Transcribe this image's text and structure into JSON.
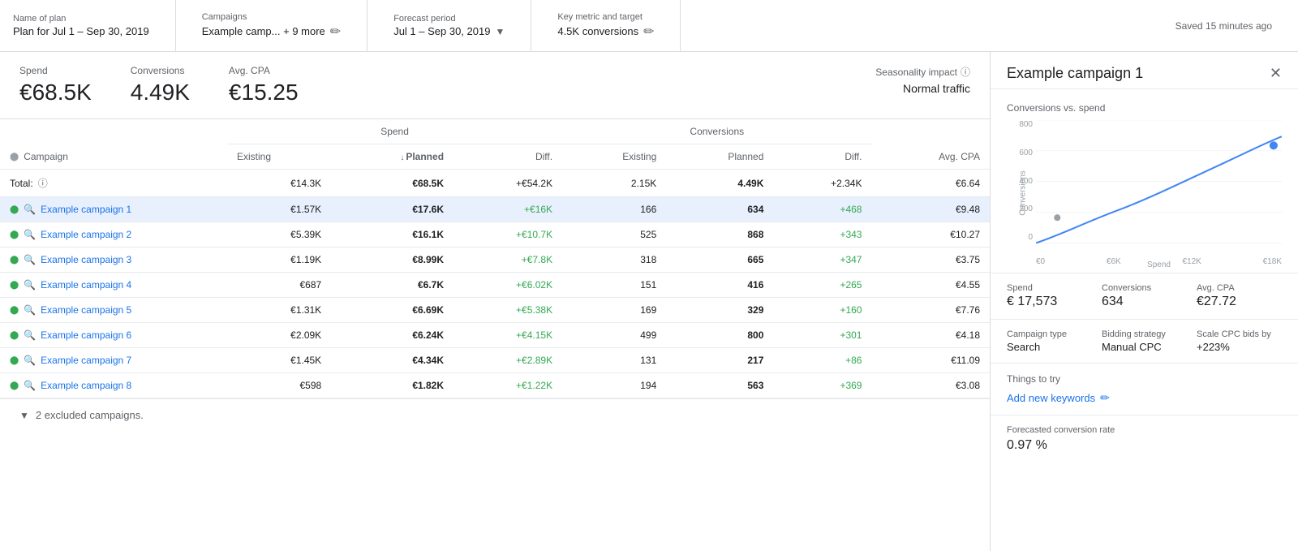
{
  "header": {
    "plan_name_label": "Name of plan",
    "plan_name": "Plan for Jul 1 – Sep 30, 2019",
    "campaigns_label": "Campaigns",
    "campaigns_value": "Example camp... + 9 more",
    "forecast_label": "Forecast period",
    "forecast_value": "Jul 1 – Sep 30, 2019",
    "metric_label": "Key metric and target",
    "metric_value": "4.5K conversions",
    "saved_text": "Saved 15 minutes ago"
  },
  "summary": {
    "spend_label": "Spend",
    "spend_value": "€68.5K",
    "conversions_label": "Conversions",
    "conversions_value": "4.49K",
    "avg_cpa_label": "Avg. CPA",
    "avg_cpa_value": "€15.25",
    "seasonality_label": "Seasonality impact",
    "seasonality_value": "Normal traffic"
  },
  "table": {
    "col_campaign": "Campaign",
    "col_spend_group": "Spend",
    "col_conv_group": "Conversions",
    "col_avg_cpa": "Avg. CPA",
    "col_existing": "Existing",
    "col_planned": "Planned",
    "col_diff": "Diff.",
    "total_label": "Total:",
    "total_spend_existing": "€14.3K",
    "total_spend_planned": "€68.5K",
    "total_spend_diff": "+€54.2K",
    "total_conv_existing": "2.15K",
    "total_conv_planned": "4.49K",
    "total_conv_diff": "+2.34K",
    "total_avg_cpa": "€6.64",
    "rows": [
      {
        "name": "Example campaign 1",
        "spend_existing": "€1.57K",
        "spend_planned": "€17.6K",
        "spend_diff": "+€16K",
        "conv_existing": "166",
        "conv_planned": "634",
        "conv_diff": "+468",
        "avg_cpa": "€9.48",
        "selected": true
      },
      {
        "name": "Example campaign 2",
        "spend_existing": "€5.39K",
        "spend_planned": "€16.1K",
        "spend_diff": "+€10.7K",
        "conv_existing": "525",
        "conv_planned": "868",
        "conv_diff": "+343",
        "avg_cpa": "€10.27",
        "selected": false
      },
      {
        "name": "Example campaign 3",
        "spend_existing": "€1.19K",
        "spend_planned": "€8.99K",
        "spend_diff": "+€7.8K",
        "conv_existing": "318",
        "conv_planned": "665",
        "conv_diff": "+347",
        "avg_cpa": "€3.75",
        "selected": false
      },
      {
        "name": "Example campaign 4",
        "spend_existing": "€687",
        "spend_planned": "€6.7K",
        "spend_diff": "+€6.02K",
        "conv_existing": "151",
        "conv_planned": "416",
        "conv_diff": "+265",
        "avg_cpa": "€4.55",
        "selected": false
      },
      {
        "name": "Example campaign 5",
        "spend_existing": "€1.31K",
        "spend_planned": "€6.69K",
        "spend_diff": "+€5.38K",
        "conv_existing": "169",
        "conv_planned": "329",
        "conv_diff": "+160",
        "avg_cpa": "€7.76",
        "selected": false
      },
      {
        "name": "Example campaign 6",
        "spend_existing": "€2.09K",
        "spend_planned": "€6.24K",
        "spend_diff": "+€4.15K",
        "conv_existing": "499",
        "conv_planned": "800",
        "conv_diff": "+301",
        "avg_cpa": "€4.18",
        "selected": false
      },
      {
        "name": "Example campaign 7",
        "spend_existing": "€1.45K",
        "spend_planned": "€4.34K",
        "spend_diff": "+€2.89K",
        "conv_existing": "131",
        "conv_planned": "217",
        "conv_diff": "+86",
        "avg_cpa": "€11.09",
        "selected": false
      },
      {
        "name": "Example campaign 8",
        "spend_existing": "€598",
        "spend_planned": "€1.82K",
        "spend_diff": "+€1.22K",
        "conv_existing": "194",
        "conv_planned": "563",
        "conv_diff": "+369",
        "avg_cpa": "€3.08",
        "selected": false
      }
    ]
  },
  "excluded": {
    "text": "2 excluded campaigns."
  },
  "right_panel": {
    "title": "Example campaign 1",
    "chart_title": "Conversions vs. spend",
    "chart_y_labels": [
      "800",
      "600",
      "400",
      "200",
      "0"
    ],
    "chart_x_labels": [
      "€0",
      "€6K",
      "€12K",
      "€18K"
    ],
    "chart_y_axis_label": "Conversions",
    "chart_x_axis_label": "Spend",
    "spend_label": "Spend",
    "spend_value": "€ 17,573",
    "conversions_label": "Conversions",
    "conversions_value": "634",
    "avg_cpa_label": "Avg. CPA",
    "avg_cpa_value": "€27.72",
    "campaign_type_label": "Campaign type",
    "campaign_type_value": "Search",
    "bidding_strategy_label": "Bidding strategy",
    "bidding_strategy_value": "Manual CPC",
    "scale_cpc_label": "Scale CPC bids by",
    "scale_cpc_value": "+223%",
    "things_label": "Things to try",
    "things_item": "Add new keywords",
    "forecast_label": "Forecasted conversion rate",
    "forecast_value": "0.97 %"
  }
}
